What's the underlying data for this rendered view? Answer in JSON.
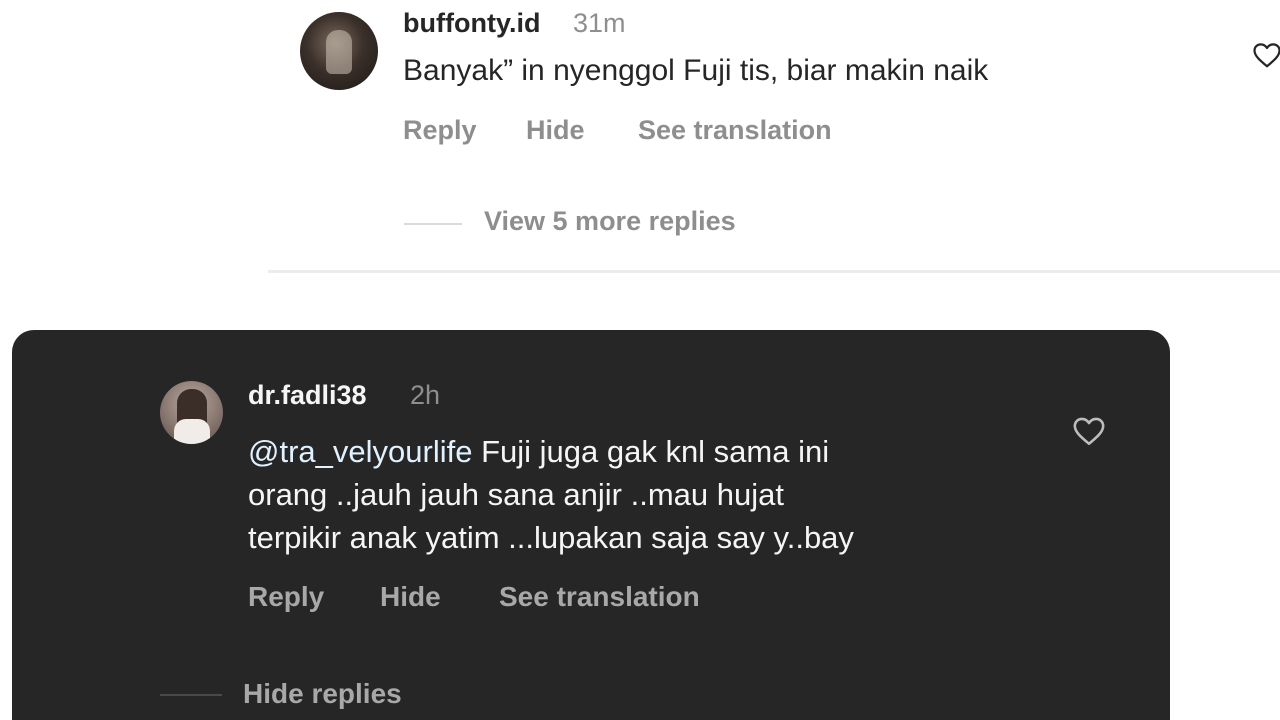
{
  "top_comment": {
    "username": "buffonty.id",
    "time": "31m",
    "text": "Banyak” in nyenggol Fuji tis, biar makin naik",
    "actions": {
      "reply": "Reply",
      "hide": "Hide",
      "see_translation": "See translation"
    },
    "view_more_replies": "View 5 more replies"
  },
  "highlighted_comment": {
    "username": "dr.fadli38",
    "time": "2h",
    "mention": "@tra_velyourlife",
    "text_lines": [
      " Fuji juga gak knl sama ini",
      "orang ..jauh jauh sana anjir ..mau hujat",
      "terpikir anak yatim ...lupakan saja say y..bay"
    ],
    "actions": {
      "reply": "Reply",
      "hide": "Hide",
      "see_translation": "See translation"
    },
    "hide_replies": "Hide replies"
  },
  "icons": {
    "like": "heart-outline-icon",
    "avatar": "profile-photo"
  },
  "colors": {
    "light_bg": "#ffffff",
    "dark_card_bg": "#262626",
    "primary_text_light": "#262626",
    "secondary_text": "#8e8e8e",
    "primary_text_dark": "#f5f5f5",
    "mention_dark": "#e0f1ff"
  }
}
